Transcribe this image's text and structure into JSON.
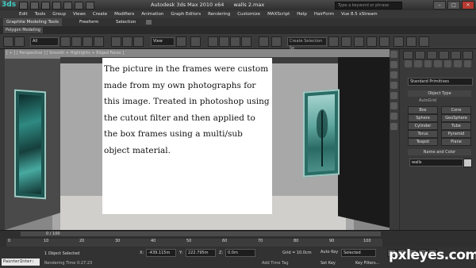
{
  "window": {
    "app_logo": "3ds",
    "app_name": "Autodesk 3ds Max  2010 x64",
    "file_name": "walls 2.max",
    "search_placeholder": "Type a keyword or phrase",
    "minimize": "–",
    "maximize": "□",
    "close": "✕"
  },
  "menu": [
    "Edit",
    "Tools",
    "Group",
    "Views",
    "Create",
    "Modifiers",
    "Animation",
    "Graph Editors",
    "Rendering",
    "Customize",
    "MAXScript",
    "Help",
    "HairForm",
    "Vue 8.5 xStream"
  ],
  "ribbon": {
    "tabs": [
      "Graphite Modeling Tools",
      "Freeform",
      "Selection"
    ],
    "subtab": "Polygon Modeling"
  },
  "toolbar": {
    "filter_value": "All",
    "ref_coord": "View",
    "selection_set": "Create Selection Se"
  },
  "viewport": {
    "label": "[ + ] [ Perspective ] [ Smooth + Highlights + Edged Faces ]"
  },
  "caption": {
    "text": "The picture in the frames were custom made from my own photographs for this image.  Treated in photoshop using the cutout filter and then applied to the box frames using a multi/sub object material."
  },
  "command_panel": {
    "dropdown": "Standard Primitives",
    "object_type_title": "Object Type",
    "autogrid_label": "AutoGrid",
    "buttons": [
      "Box",
      "Cone",
      "Sphere",
      "GeoSphere",
      "Cylinder",
      "Tube",
      "Torus",
      "Pyramid",
      "Teapot",
      "Plane"
    ],
    "name_color_title": "Name and Color",
    "name_value": "walls"
  },
  "timeline": {
    "frame_counter": "0 / 100",
    "ticks": [
      "0",
      "10",
      "20",
      "30",
      "40",
      "50",
      "60",
      "70",
      "80",
      "90",
      "100"
    ]
  },
  "status": {
    "maxscript": "PainterInter:",
    "selection_info": "1 Object Selected",
    "render_time": "Rendering Time  0:27:23",
    "x_label": "X:",
    "x_value": "-439.115m",
    "y_label": "Y:",
    "y_value": "222.795m",
    "z_label": "Z:",
    "z_value": "0.0m",
    "grid": "Grid = 10.0cm",
    "add_time_tag": "Add Time Tag",
    "auto_key": "Auto Key",
    "selected_dropdown": "Selected",
    "set_key": "Set Key",
    "key_filters": "Key Filters..."
  },
  "watermark": "pxleyes.com",
  "colors": {
    "ui_dark": "#2b2b2b",
    "frame_teal": "#2f8a83",
    "close_red": "#b73a30"
  }
}
